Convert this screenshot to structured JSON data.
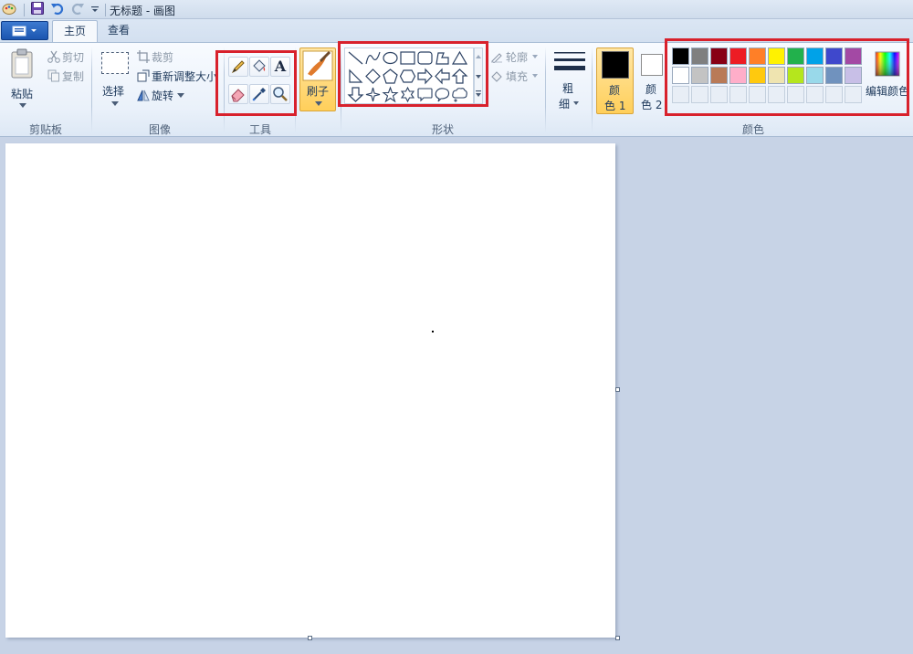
{
  "window": {
    "title": "无标题 - 画图"
  },
  "tabs": [
    {
      "label": "主页",
      "active": true
    },
    {
      "label": "查看",
      "active": false
    }
  ],
  "clipboard": {
    "paste": "粘贴",
    "cut": "剪切",
    "copy": "复制",
    "group_label": "剪贴板"
  },
  "image": {
    "select": "选择",
    "crop": "裁剪",
    "resize": "重新调整大小",
    "rotate": "旋转",
    "group_label": "图像"
  },
  "tools": {
    "group_label": "工具",
    "items": [
      "pencil-icon",
      "fill-icon",
      "text-icon",
      "eraser-icon",
      "color-picker-icon",
      "magnifier-icon"
    ],
    "text_glyph": "A"
  },
  "brushes": {
    "label": "刷子"
  },
  "shapes": {
    "group_label": "形状",
    "outline": "轮廓",
    "fill": "填充",
    "items": [
      "line",
      "curve",
      "oval",
      "rectangle",
      "rounded-rectangle",
      "polygon",
      "triangle",
      "right-triangle",
      "diamond",
      "pentagon",
      "hexagon",
      "right-arrow",
      "left-arrow",
      "up-arrow",
      "down-arrow",
      "four-point-star",
      "five-point-star",
      "six-point-star",
      "rounded-callout",
      "oval-callout",
      "cloud-callout"
    ]
  },
  "size": {
    "label_top": "粗",
    "label_bottom": "细"
  },
  "color1": {
    "label_top": "颜",
    "label_bottom": "色 1",
    "value": "#000000"
  },
  "color2": {
    "label_top": "颜",
    "label_bottom": "色 2",
    "value": "#ffffff"
  },
  "colors": {
    "group_label": "颜色",
    "edit": "编辑颜色",
    "row1": [
      "#000000",
      "#7f7f7f",
      "#880015",
      "#ed1c24",
      "#ff7f27",
      "#fff200",
      "#22b14c",
      "#00a2e8",
      "#3f48cc",
      "#a349a4"
    ],
    "row2": [
      "#ffffff",
      "#c3c3c3",
      "#b97a57",
      "#ffaec9",
      "#ffc90e",
      "#efe4b0",
      "#b5e61d",
      "#99d9ea",
      "#7092be",
      "#c8bfe7"
    ]
  }
}
